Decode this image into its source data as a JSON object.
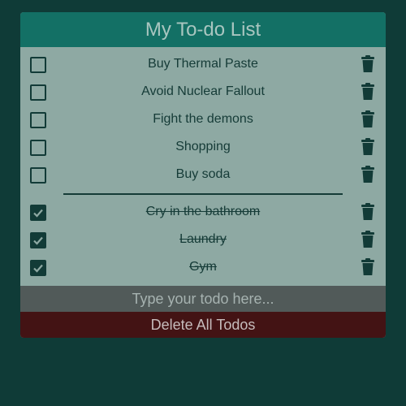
{
  "app": {
    "title": "My To-do List"
  },
  "todos": {
    "active": [
      {
        "label": "Buy Thermal Paste",
        "checked": false
      },
      {
        "label": "Avoid Nuclear Fallout",
        "checked": false
      },
      {
        "label": "Fight the demons",
        "checked": false
      },
      {
        "label": "Shopping",
        "checked": false
      },
      {
        "label": "Buy soda",
        "checked": false
      }
    ],
    "completed": [
      {
        "label": "Cry in the bathroom",
        "checked": true
      },
      {
        "label": "Laundry",
        "checked": true
      },
      {
        "label": "Gym",
        "checked": true
      }
    ]
  },
  "input": {
    "placeholder": "Type your todo here...",
    "value": ""
  },
  "footer": {
    "delete_all_label": "Delete All Todos"
  },
  "icons": {
    "checkbox": "checkbox-icon",
    "checkmark": "checkmark-icon",
    "trash": "trash-icon"
  },
  "colors": {
    "background": "#0f3b37",
    "header": "#137065",
    "list_background": "#8ea9a3",
    "text": "#153b37",
    "input_background": "#515a59",
    "delete_button": "#431314"
  }
}
